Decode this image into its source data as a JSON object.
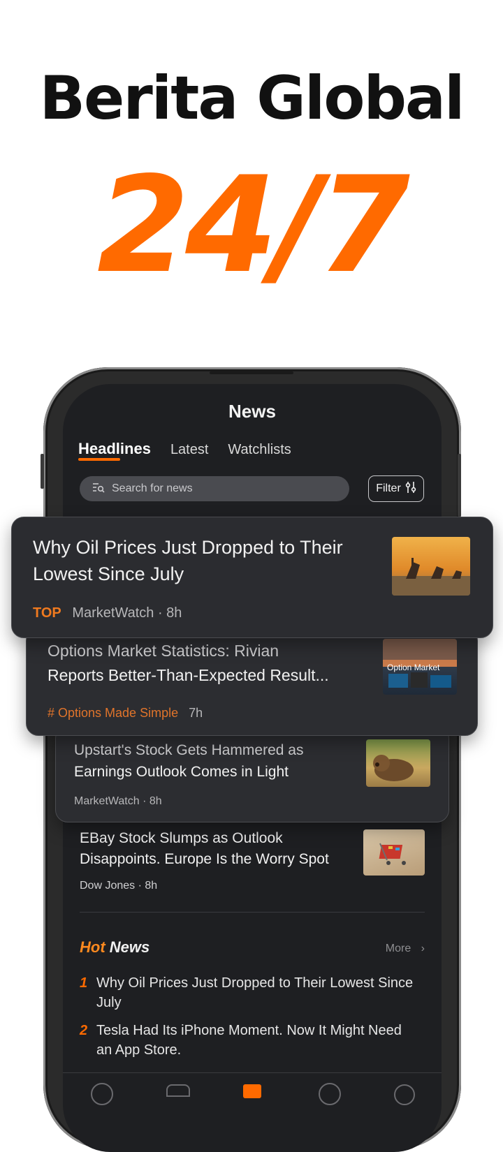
{
  "promo": {
    "title": "Berita Global",
    "big": "24/7"
  },
  "screen": {
    "title": "News",
    "tabs": [
      "Headlines",
      "Latest",
      "Watchlists"
    ],
    "search_placeholder": "Search for news",
    "filter_label": "Filter"
  },
  "articles": [
    {
      "headline_line1": "Why Oil Prices Just Dropped to Their",
      "headline_line2": "Lowest Since July",
      "tag": "TOP",
      "source_time": "MarketWatch · 8h"
    },
    {
      "headline_line1": "Options Market Statistics: Rivian",
      "headline_line2": "Reports Better-Than-Expected Result...",
      "tag": "# Options Made Simple",
      "time": "7h",
      "thumb_text": "Option Market"
    },
    {
      "headline_line1": "Upstart's Stock Gets Hammered as",
      "headline_line2": "Earnings Outlook Comes in Light",
      "source_time": "MarketWatch · 8h"
    },
    {
      "headline_line1": "EBay Stock Slumps as Outlook",
      "headline_line2": "Disappoints. Europe Is the Worry Spot",
      "source_time": "Dow Jones · 8h"
    }
  ],
  "hot": {
    "title_a": "Hot",
    "title_b": "News",
    "more": "More",
    "items": [
      {
        "rank": "1",
        "line1": "Why Oil Prices Just Dropped to Their Lowest Since",
        "line2": "July"
      },
      {
        "rank": "2",
        "line1": "Tesla Had Its iPhone Moment. Now It Might Need",
        "line2": "an App Store."
      }
    ]
  },
  "colors": {
    "accent": "#ff6a00",
    "screen_bg": "#1e1f22",
    "card_bg": "#2c2d31"
  }
}
